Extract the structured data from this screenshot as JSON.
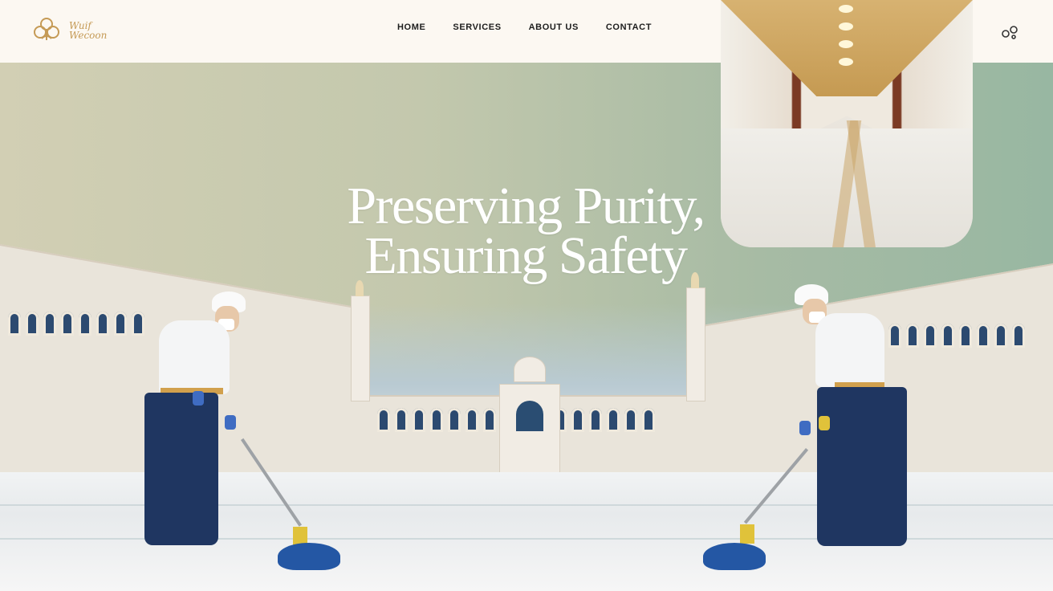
{
  "brand": {
    "logo_text": "Wuif\nWecoon",
    "logo_icon": "flower-emblem-icon",
    "accent_color": "#c59a55"
  },
  "nav": {
    "items": [
      {
        "label": "HOME"
      },
      {
        "label": "SERVICES"
      },
      {
        "label": "ABOUT US"
      },
      {
        "label": "CONTACT"
      }
    ]
  },
  "header": {
    "util_icon": "link-rings-icon"
  },
  "hero": {
    "headline_line1": "Preserving Purity,",
    "headline_line2": "Ensuring Safety"
  }
}
